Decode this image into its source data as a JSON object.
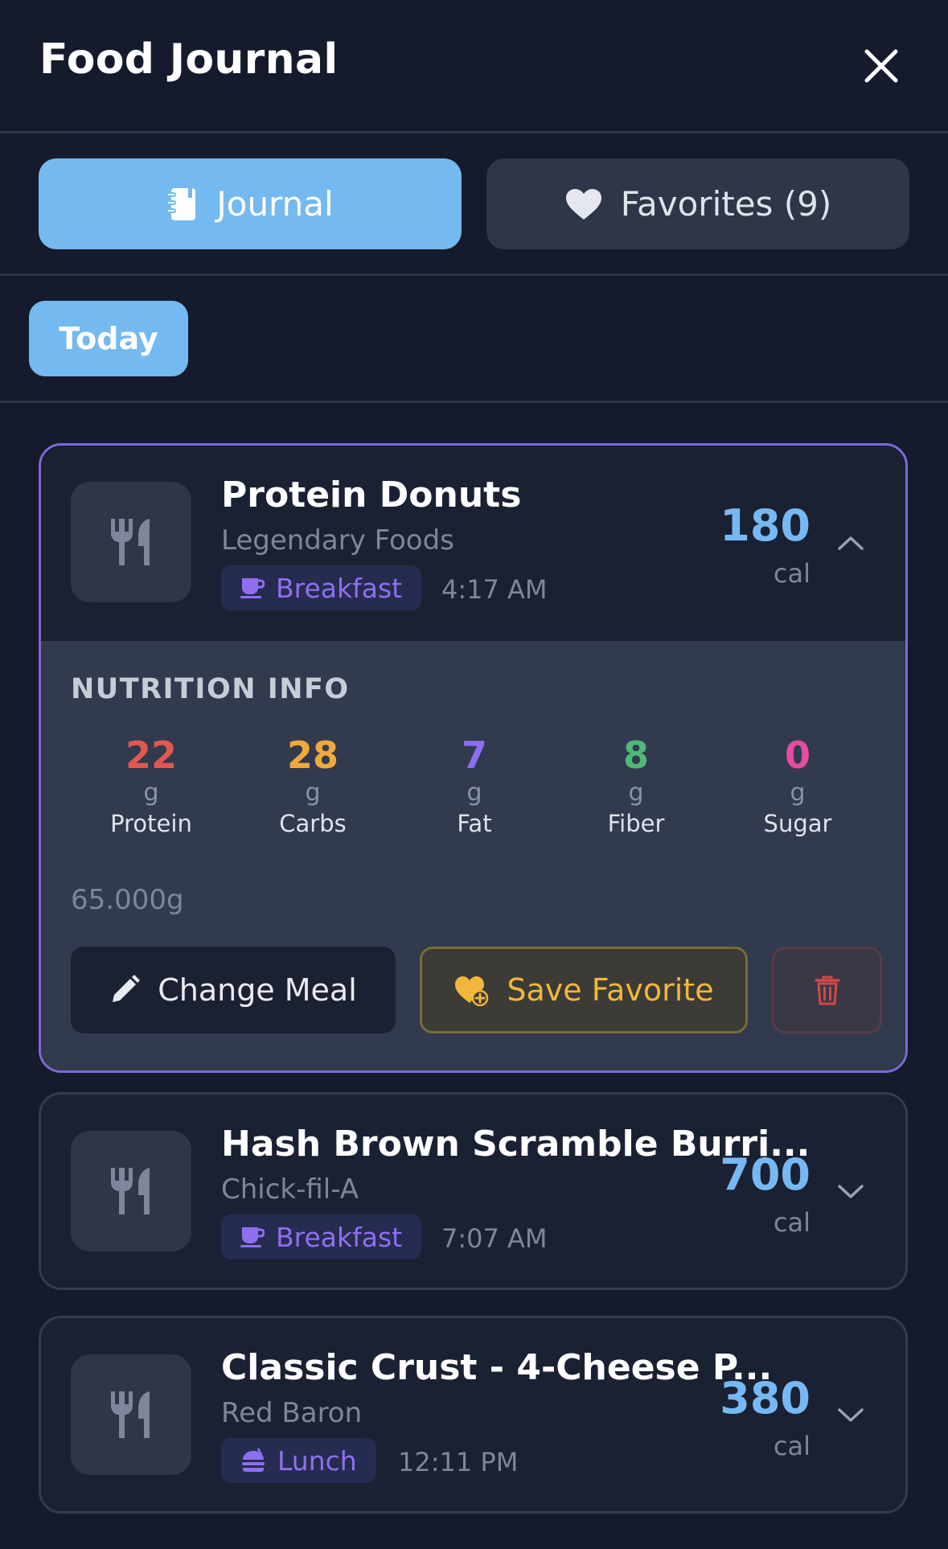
{
  "header": {
    "title": "Food Journal"
  },
  "tabs": [
    {
      "label": "Journal",
      "active": true,
      "icon": "journal-icon"
    },
    {
      "label": "Favorites (9)",
      "active": false,
      "icon": "heart-icon"
    }
  ],
  "date_filter": {
    "label": "Today"
  },
  "entries": [
    {
      "name": "Protein Donuts",
      "brand": "Legendary Foods",
      "meal": "Breakfast",
      "meal_icon": "coffee-cup-icon",
      "time": "4:17 AM",
      "calories": "180",
      "cal_unit": "cal",
      "expanded": true,
      "nutrition": {
        "heading": "NUTRITION INFO",
        "macros": [
          {
            "value": "22",
            "unit": "g",
            "name": "Protein",
            "color": "#e0584f"
          },
          {
            "value": "28",
            "unit": "g",
            "name": "Carbs",
            "color": "#f0a93b"
          },
          {
            "value": "7",
            "unit": "g",
            "name": "Fat",
            "color": "#8d6ef2"
          },
          {
            "value": "8",
            "unit": "g",
            "name": "Fiber",
            "color": "#4fb777"
          },
          {
            "value": "0",
            "unit": "g",
            "name": "Sugar",
            "color": "#e64ba0"
          }
        ],
        "serving": "65.000g"
      },
      "actions": {
        "change": "Change Meal",
        "save": "Save Favorite"
      }
    },
    {
      "name": "Hash Brown Scramble Burri...",
      "brand": "Chick-fil-A",
      "meal": "Breakfast",
      "meal_icon": "coffee-cup-icon",
      "time": "7:07 AM",
      "calories": "700",
      "cal_unit": "cal",
      "expanded": false
    },
    {
      "name": "Classic Crust - 4-Cheese P...",
      "brand": "Red Baron",
      "meal": "Lunch",
      "meal_icon": "burger-icon",
      "time": "12:11 PM",
      "calories": "380",
      "cal_unit": "cal",
      "expanded": false
    }
  ],
  "colors": {
    "background": "#151b2c",
    "accent": "#74b9ef",
    "calories": "#78b8f2",
    "meal_badge": "#8f6ff0",
    "expanded_border": "#7f66d8",
    "favorite": "#f2b63a",
    "delete": "#d14848"
  }
}
